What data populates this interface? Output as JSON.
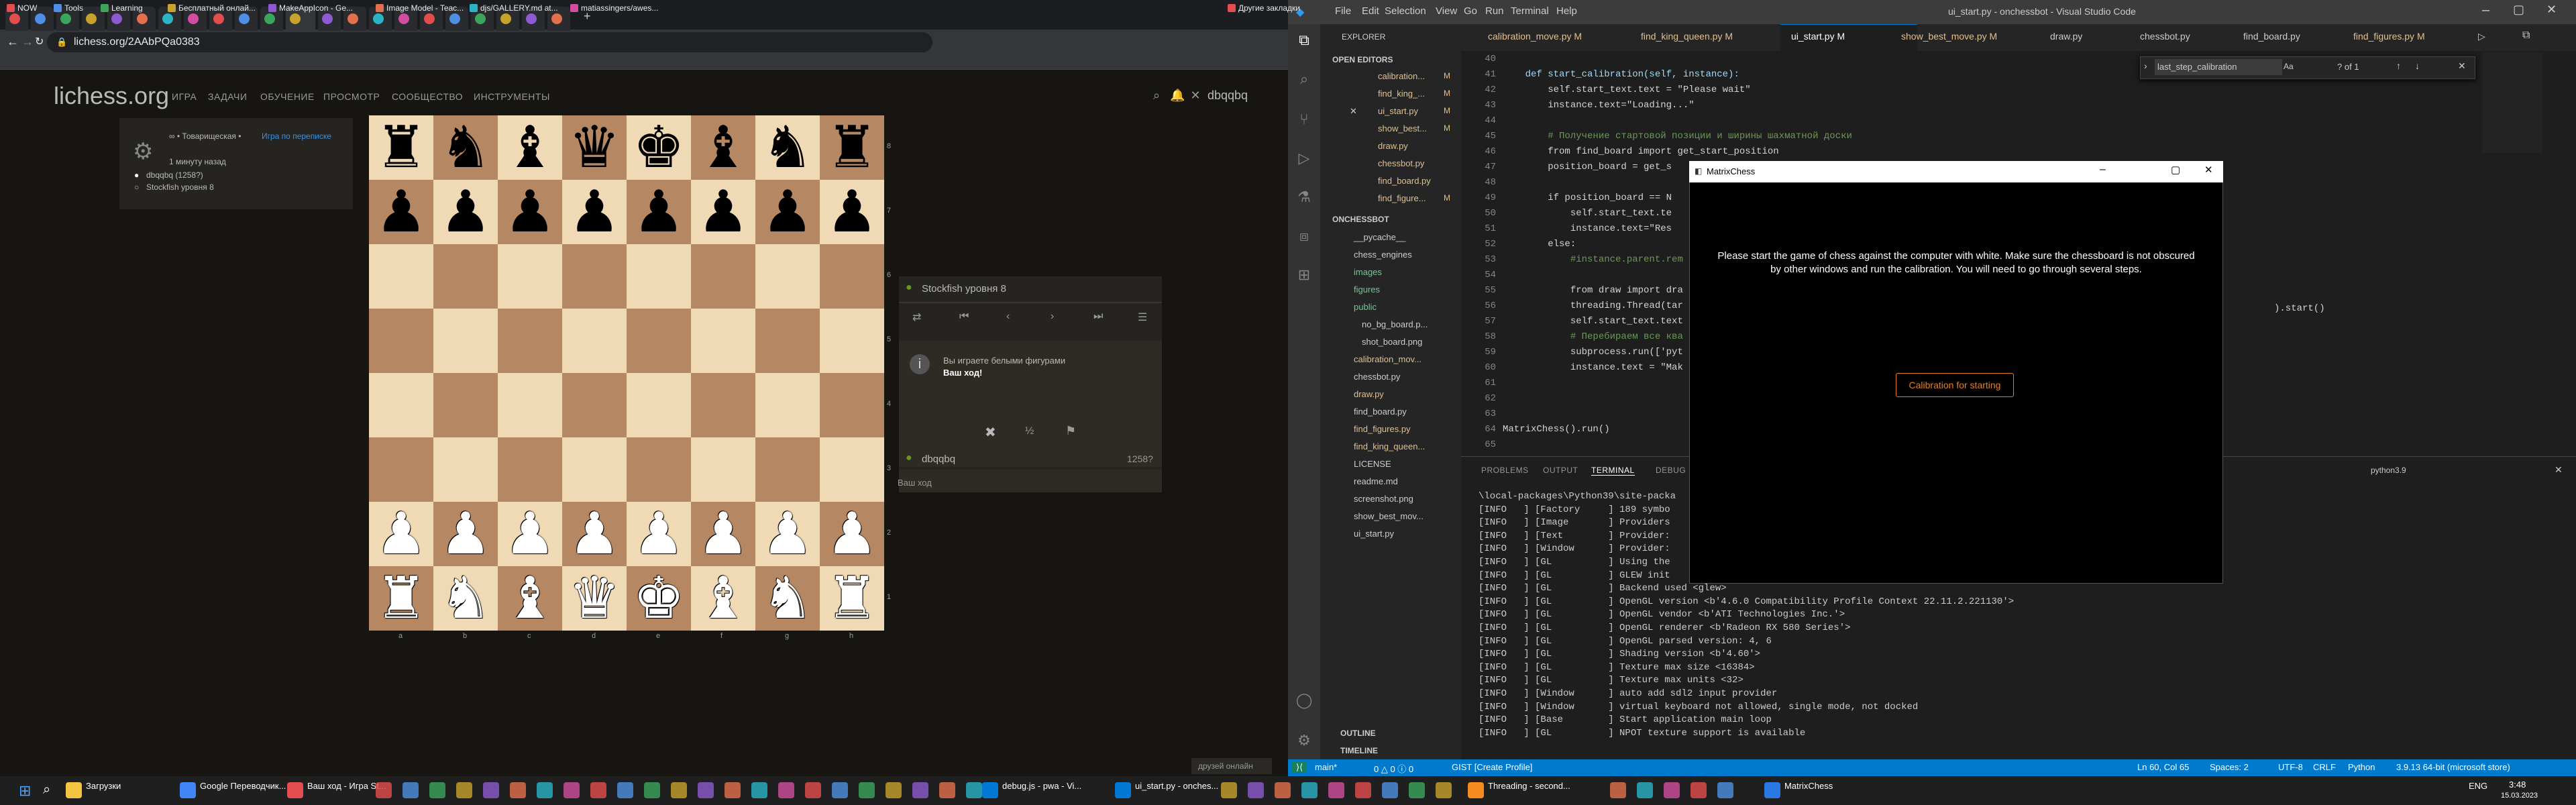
{
  "browser": {
    "url": "lichess.org/2AAbPQa0383",
    "bookmarks": [
      "NOW",
      "Tools",
      "Learning",
      "Бесплатный онлай...",
      "MakeAppIcon - Ge...",
      "Image Model - Teac...",
      "djs/GALLERY.md at...",
      "matiassingers/awes...",
      "Другие закладки"
    ]
  },
  "lichess": {
    "logo": "lichess.org",
    "nav": [
      "ИГРА",
      "ЗАДАЧИ",
      "ОБУЧЕНИЕ",
      "ПРОСМОТР",
      "СООБЩЕСТВО",
      "ИНСТРУМЕНТЫ"
    ],
    "username": "dbqqbq",
    "game_type_prefix": "∞ • Товарищеская •",
    "game_type_link": "Игра по переписке",
    "game_time": "1 минуту назад",
    "white_player": "dbqqbq (1258?)",
    "black_player": "Stockfish уровня 8",
    "opponent_header": "Stockfish уровня 8",
    "you_play": "Вы играете белыми фигурами",
    "your_move": "Ваш ход!",
    "player_name": "dbqqbq",
    "player_rating": "1258?",
    "bottom_note": "Ваш ход",
    "friends": "друзей онлайн",
    "files": [
      "a",
      "b",
      "c",
      "d",
      "e",
      "f",
      "g",
      "h"
    ],
    "ranks": [
      "8",
      "7",
      "6",
      "5",
      "4",
      "3",
      "2",
      "1"
    ]
  },
  "vscode": {
    "title": "ui_start.py - onchessbot - Visual Studio Code",
    "menu": [
      "File",
      "Edit",
      "Selection",
      "View",
      "Go",
      "Run",
      "Terminal",
      "Help"
    ],
    "explorer_title": "EXPLORER",
    "open_editors_title": "OPEN EDITORS",
    "open_editors": [
      "calibration...",
      "find_king_...",
      "ui_start.py",
      "show_best...",
      "draw.py",
      "chessbot.py",
      "find_board.py",
      "find_figure..."
    ],
    "project": "ONCHESSBOT",
    "tree": [
      "__pycache__",
      "chess_engines",
      "images",
      "figures",
      "public",
      "no_bg_board.p...",
      "shot_board.png",
      "calibration_mov...",
      "chessbot.py",
      "draw.py",
      "find_board.py",
      "find_figures.py",
      "find_king_queen...",
      "LICENSE",
      "readme.md",
      "screenshot.png",
      "show_best_mov...",
      "ui_start.py"
    ],
    "outline": "OUTLINE",
    "timeline": "TIMELINE",
    "tabs": [
      "calibration_move.py M",
      "find_king_queen.py M",
      "ui_start.py M",
      "show_best_move.py M",
      "draw.py",
      "chessbot.py",
      "find_board.py",
      "find_figures.py M"
    ],
    "find_text": "last_step_calibration",
    "find_count": "? of 1",
    "line_numbers": [
      "40",
      "41",
      "42",
      "43",
      "44",
      "45",
      "46",
      "47",
      "48",
      "49",
      "50",
      "51",
      "52",
      "53",
      "54",
      "55",
      "56",
      "57",
      "58",
      "59",
      "60",
      "61",
      "62",
      "63",
      "64",
      "65"
    ],
    "code": [
      "",
      "    def start_calibration(self, instance):",
      "        self.start_text.text = \"Please wait\"",
      "        instance.text=\"Loading...\"",
      "",
      "        # Получение стартовой позиции и ширины шахматной доски",
      "        from find_board import get_start_position",
      "        position_board = get_s",
      "",
      "        if position_board == N",
      "            self.start_text.te",
      "            instance.text=\"Res",
      "        else:",
      "            #instance.parent.rem",
      "",
      "            from draw import dra",
      "            threading.Thread(tar",
      "            self.start_text.text",
      "            # Перебираем все ква",
      "            subprocess.run(['pyt",
      "            instance.text = \"Mak",
      "",
      "",
      "",
      "MatrixChess().run()",
      ""
    ],
    "code_tail": ").start()",
    "panel_tabs": [
      "PROBLEMS",
      "OUTPUT",
      "TERMINAL",
      "DEBUG"
    ],
    "python_env": "python3.9",
    "terminal": [
      "\\local-packages\\Python39\\site-packa",
      "[INFO   ] [Factory     ] 189 symbo",
      "[INFO   ] [Image       ] Providers",
      "[INFO   ] [Text        ] Provider:",
      "[INFO   ] [Window      ] Provider:",
      "[INFO   ] [GL          ] Using the",
      "[INFO   ] [GL          ] GLEW init",
      "[INFO   ] [GL          ] Backend used <glew>",
      "[INFO   ] [GL          ] OpenGL version <b'4.6.0 Compatibility Profile Context 22.11.2.221130'>",
      "[INFO   ] [GL          ] OpenGL vendor <b'ATI Technologies Inc.'>",
      "[INFO   ] [GL          ] OpenGL renderer <b'Radeon RX 580 Series'>",
      "[INFO   ] [GL          ] OpenGL parsed version: 4, 6",
      "[INFO   ] [GL          ] Shading version <b'4.60'>",
      "[INFO   ] [GL          ] Texture max size <16384>",
      "[INFO   ] [GL          ] Texture max units <32>",
      "[INFO   ] [Window      ] auto add sdl2 input provider",
      "[INFO   ] [Window      ] virtual keyboard not allowed, single mode, not docked",
      "[INFO   ] [Base        ] Start application main loop",
      "[INFO   ] [GL          ] NPOT texture support is available"
    ],
    "status_left": [
      "main*",
      "0 △ 0 ⓘ 0",
      "GIST [Create Profile]"
    ],
    "status_right": [
      "Ln 60, Col 65",
      "Spaces: 2",
      "UTF-8",
      "CRLF",
      "Python",
      "3.9.13 64-bit (microsoft store)"
    ]
  },
  "dialog": {
    "title": "MatrixChess",
    "message": "Please start the game of chess against the computer with white. Make sure the chessboard is not obscured by other windows and run the calibration. You will need to go through several steps.",
    "button": "Calibration for starting"
  },
  "taskbar": {
    "items": [
      "Загрузки",
      "Google Переводчик...",
      "Ваш ход - Игра St...",
      "debug.js - pwa - Vi...",
      "ui_start.py - onches...",
      "Threading - second...",
      "MatrixChess"
    ],
    "tray": [
      "ENG",
      "3:48",
      "15.03.2023"
    ]
  },
  "colors": {
    "light_square": "#f0d9b5",
    "dark_square": "#b58863",
    "vscode_blue": "#007acc",
    "calib_orange": "#e67e22"
  },
  "board": [
    [
      "r",
      "n",
      "b",
      "q",
      "k",
      "b",
      "n",
      "r"
    ],
    [
      "p",
      "p",
      "p",
      "p",
      "p",
      "p",
      "p",
      "p"
    ],
    [
      "",
      "",
      "",
      "",
      "",
      "",
      "",
      ""
    ],
    [
      "",
      "",
      "",
      "",
      "",
      "",
      "",
      ""
    ],
    [
      "",
      "",
      "",
      "",
      "",
      "",
      "",
      ""
    ],
    [
      "",
      "",
      "",
      "",
      "",
      "",
      "",
      ""
    ],
    [
      "P",
      "P",
      "P",
      "P",
      "P",
      "P",
      "P",
      "P"
    ],
    [
      "R",
      "N",
      "B",
      "Q",
      "K",
      "B",
      "N",
      "R"
    ]
  ]
}
